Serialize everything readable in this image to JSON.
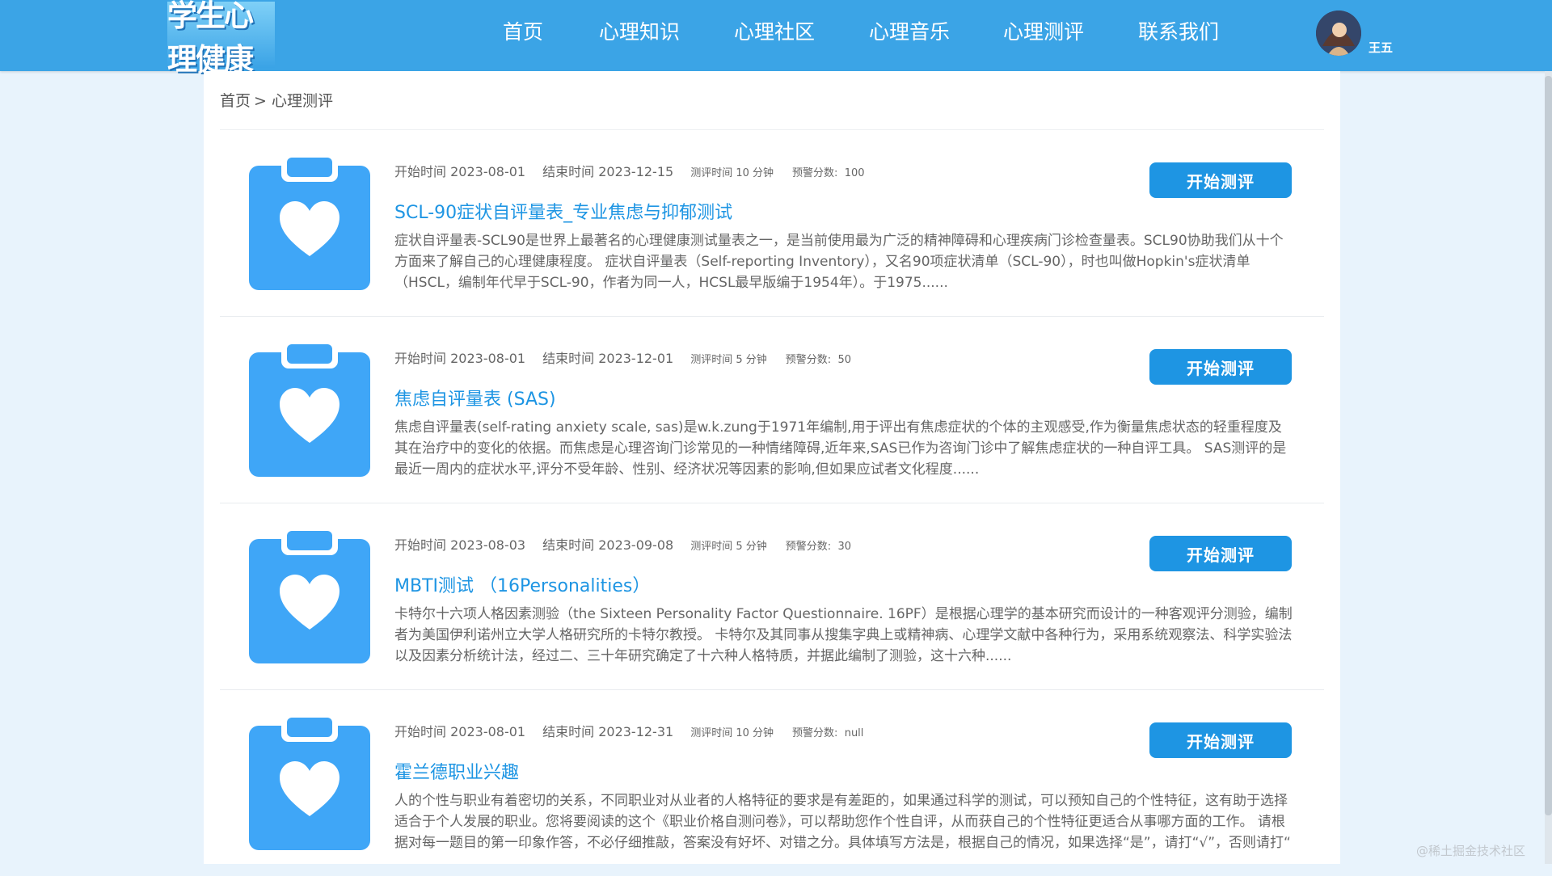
{
  "header": {
    "logo_text": "学生心理健康",
    "nav": [
      "首页",
      "心理知识",
      "心理社区",
      "心理音乐",
      "心理测评",
      "联系我们"
    ],
    "username": "王五",
    "bg_color": "#3ba4e6"
  },
  "breadcrumb": {
    "home": "首页",
    "separator": ">",
    "current": "心理测评"
  },
  "start_button_label": "开始测评",
  "labels": {
    "start_time": "开始时间",
    "end_time": "结束时间",
    "duration": "测评时间",
    "minutes": "分钟",
    "warning_score": "预警分数:"
  },
  "assessments": [
    {
      "start": "2023-08-01",
      "end": "2023-12-15",
      "duration": "10",
      "warning": "100",
      "title": "SCL-90症状自评量表_专业焦虑与抑郁测试",
      "description": "症状自评量表-SCL90是世界上最著名的心理健康测试量表之一，是当前使用最为广泛的精神障碍和心理疾病门诊检查量表。SCL90协助我们从十个方面来了解自己的心理健康程度。 症状自评量表（Self-reporting Inventory），又名90项症状清单（SCL-90），时也叫做Hopkin's症状清单（HSCL，编制年代早于SCL-90，作者为同一人，HCSL最早版编于1954年）。于1975......"
    },
    {
      "start": "2023-08-01",
      "end": "2023-12-01",
      "duration": "5",
      "warning": "50",
      "title": "焦虑自评量表 (SAS)",
      "description": "焦虑自评量表(self-rating anxiety scale, sas)是w.k.zung于1971年编制,用于评出有焦虑症状的个体的主观感受,作为衡量焦虑状态的轻重程度及其在治疗中的变化的依据。而焦虑是心理咨询门诊常见的一种情绪障碍,近年来,SAS已作为咨询门诊中了解焦虑症状的一种自评工具。 SAS测评的是最近一周内的症状水平,评分不受年龄、性别、经济状况等因素的影响,但如果应试者文化程度......"
    },
    {
      "start": "2023-08-03",
      "end": "2023-09-08",
      "duration": "5",
      "warning": "30",
      "title": "MBTI测试 （16Personalities）",
      "description": "卡特尔十六项人格因素测验（the Sixteen Personality Factor Questionnaire. 16PF）是根据心理学的基本研究而设计的一种客观评分测验，编制者为美国伊利诺州立大学人格研究所的卡特尔教授。 卡特尔及其同事从搜集字典上或精神病、心理学文献中各种行为，采用系统观察法、科学实验法以及因素分析统计法，经过二、三十年研究确定了十六种人格特质，并据此编制了测验，这十六种......"
    },
    {
      "start": "2023-08-01",
      "end": "2023-12-31",
      "duration": "10",
      "warning": "null",
      "title": "霍兰德职业兴趣",
      "description": "人的个性与职业有着密切的关系，不同职业对从业者的人格特征的要求是有差距的，如果通过科学的测试，可以预知自己的个性特征，这有助于选择适合于个人发展的职业。您将要阅读的这个《职业价格自测问卷》，可以帮助您作个性自评，从而获自己的个性特征更适合从事哪方面的工作。 请根据对每一题目的第一印象作答，不必仔细推敲，答案没有好坏、对错之分。具体填写方法是，根据自己的情况，如果选择“是”，请打“√”，否则请打“"
    }
  ],
  "icon": "clipboard-heart-icon",
  "accent_color": "#1e95e3",
  "watermark": "@稀土掘金技术社区"
}
